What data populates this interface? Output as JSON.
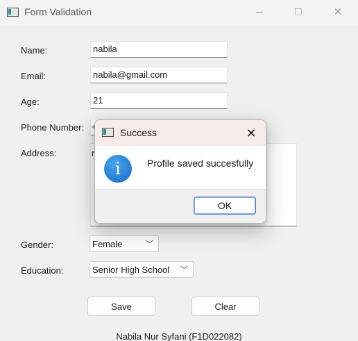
{
  "window": {
    "title": "Form Validation",
    "minimize_glyph": "",
    "close_glyph": "✕"
  },
  "form": {
    "name": {
      "label": "Name:",
      "value": "nabila"
    },
    "email": {
      "label": "Email:",
      "value": "nabila@gmail.com"
    },
    "age": {
      "label": "Age:",
      "value": "21"
    },
    "phone": {
      "label": "Phone Number:",
      "visible_value": "+"
    },
    "address": {
      "label": "Address:",
      "visible_value": "r"
    },
    "gender": {
      "label": "Gender:",
      "selected": "Female"
    },
    "education": {
      "label": "Education:",
      "selected": "Senior High School"
    },
    "save_label": "Save",
    "clear_label": "Clear"
  },
  "footer": {
    "text": "Nabila Nur Syfani (F1D022082)"
  },
  "dialog": {
    "title": "Success",
    "message": "Profile saved succesfully",
    "ok_label": "OK",
    "close_glyph": "✕",
    "info_glyph": "i",
    "info_color": "#1f7fd6"
  },
  "icons": {
    "app": "app-window-icon",
    "dropdown": "chevron-down-icon",
    "info": "info-icon"
  }
}
